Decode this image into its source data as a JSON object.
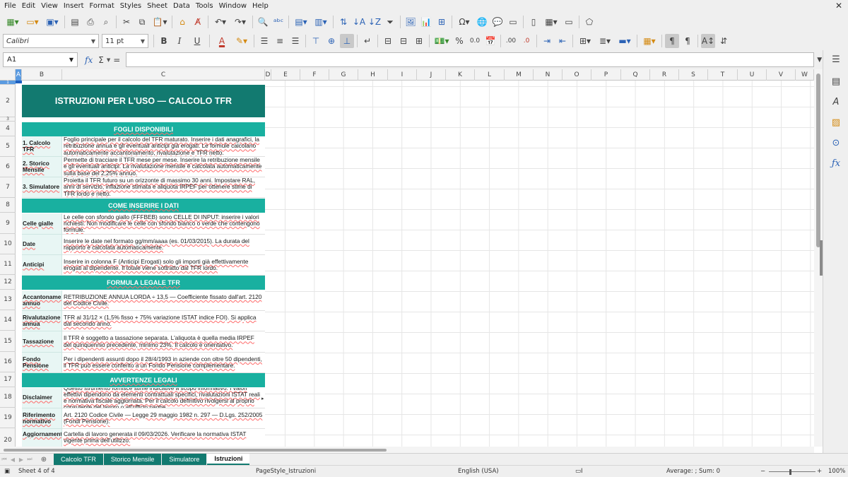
{
  "menu": [
    "File",
    "Edit",
    "View",
    "Insert",
    "Format",
    "Styles",
    "Sheet",
    "Data",
    "Tools",
    "Window",
    "Help"
  ],
  "toolbar": {
    "font_name": "Calibri",
    "font_size": "11 pt",
    "bold": "B",
    "italic": "I",
    "underline": "U",
    "font_color": "A",
    "percent": "%",
    "decimal": "0.0",
    "dec_add": ".00",
    "dec_del": ".0"
  },
  "formula_bar": {
    "cell_ref": "A1",
    "fx": "fx",
    "sigma": "Σ",
    "equals": "=",
    "content": ""
  },
  "columns": [
    "A",
    "B",
    "C",
    "D",
    "E",
    "F",
    "G",
    "H",
    "I",
    "J",
    "K",
    "L",
    "M",
    "N",
    "O",
    "P",
    "Q",
    "R",
    "S",
    "T",
    "U",
    "V",
    "W"
  ],
  "rows": [
    "1",
    "2",
    "3",
    "4",
    "5",
    "6",
    "7",
    "8",
    "9",
    "10",
    "11",
    "12",
    "13",
    "14",
    "15",
    "16",
    "17",
    "18",
    "19",
    "20"
  ],
  "document": {
    "title": "ISTRUZIONI PER L'USO — CALCOLO TFR",
    "section_fogli": "FOGLI DISPONIBILI",
    "fogli": [
      {
        "label": "1. Calcolo TFR",
        "text": "Foglio principale per il calcolo del TFR maturato. Inserire i dati anagrafici, la retribuzione annua e gli eventuali anticipi già erogati. Le formule calcolano automaticamente accantonamento, rivalutazione e TFR netto."
      },
      {
        "label": "2. Storico Mensile",
        "text": "Permette di tracciare il TFR mese per mese. Inserire la retribuzione mensile e gli eventuali anticipi. La rivalutazione mensile è calcolata automaticamente sulla base del 2,25% annuo."
      },
      {
        "label": "3. Simulatore",
        "text": "Proietta il TFR futuro su un orizzonte di massimo 30 anni. Impostare RAL, anni di servizio, inflazione stimata e aliquota IRPEF per ottenere stime di TFR lordo e netto."
      }
    ],
    "section_come": "COME INSERIRE I DATI",
    "come": [
      {
        "label": "Celle gialle",
        "text": "Le celle con sfondo giallo (FFFBEB) sono CELLE DI INPUT: inserire i valori richiesti. Non modificare le celle con sfondo bianco o verde che contengono formule."
      },
      {
        "label": "Date",
        "text": "Inserire le date nel formato gg/mm/aaaa (es. 01/03/2015). La durata del rapporto è calcolata automaticamente."
      },
      {
        "label": "Anticipi",
        "text": "Inserire in colonna F (Anticipi Erogati) solo gli importi già effettivamente erogati al dipendente. Il totale viene sottratto dal TFR lordo."
      }
    ],
    "section_formula": "FORMULA LEGALE TFR",
    "formula": [
      {
        "label": "Accantonamento annuo",
        "text": "RETRIBUZIONE ANNUA LORDA ÷ 13,5 — Coefficiente fissato dall'art. 2120 del Codice Civile."
      },
      {
        "label": "Rivalutazione annua",
        "text": "TFR al 31/12 × (1,5% fisso + 75% variazione ISTAT indice FOI). Si applica dal secondo anno."
      },
      {
        "label": "Tassazione",
        "text": "Il TFR è soggetto a tassazione separata. L'aliquota è quella media IRPEF del quinquennio precedente, minimo 23%. Il calcolo è orientativo."
      },
      {
        "label": "Fondo Pensione",
        "text": "Per i dipendenti assunti dopo il 28/4/1993 in aziende con oltre 50 dipendenti, il TFR può essere conferito a un Fondo Pensione complementare."
      }
    ],
    "section_avvertenze": "AVVERTENZE LEGALI",
    "avvertenze": [
      {
        "label": "Disclaimer",
        "text": "Questo strumento fornisce stime indicative a scopo informativo. I valori effettivi dipendono da elementi contrattuali specifici, rivalutazioni ISTAT reali e normativa fiscale aggiornata. Per il calcolo definitivo rivolgersi al proprio consulente del lavoro o all'ufficio paghe."
      },
      {
        "label": "Riferimento normativo",
        "text": "Art. 2120 Codice Civile — Legge 29 maggio 1982 n. 297 — D.Lgs. 252/2005 (Fondi Pensione)."
      },
      {
        "label": "Aggiornamento",
        "text": "Cartella di lavoro generata il 09/03/2026. Verificare la normativa ISTAT vigente prima dell'utilizzo."
      }
    ]
  },
  "tabs": [
    "Calcolo TFR",
    "Storico Mensile",
    "Simulatore",
    "Istruzioni"
  ],
  "active_tab": "Istruzioni",
  "status": {
    "sheet": "Sheet 4 of 4",
    "page_style": "PageStyle_Istruzioni",
    "language": "English (USA)",
    "summary": "Average: ; Sum: 0",
    "zoom": "100%"
  },
  "colors": {
    "title_bg": "#127a70",
    "section_bg": "#19b0a0",
    "label_bg": "#e8f6f4",
    "tab_bg": "#127a70"
  }
}
